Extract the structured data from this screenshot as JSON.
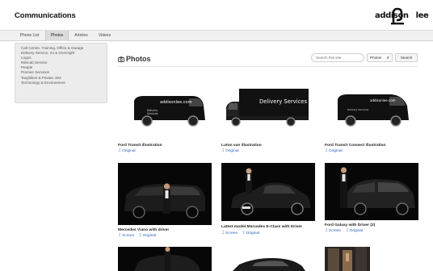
{
  "header": {
    "title": "Communications",
    "logo_text": "addison",
    "logo_text_2": "lee"
  },
  "nav": {
    "tabs": [
      {
        "label": "Phone List",
        "active": false
      },
      {
        "label": "Photos",
        "active": true
      },
      {
        "label": "Articles",
        "active": false
      },
      {
        "label": "Videos",
        "active": false
      }
    ]
  },
  "photos_menu": {
    "items": [
      "Call Centre, Training, Office & Garage",
      "Delivery Service, Int & Overnight",
      "Logos",
      "Minicab Service",
      "People",
      "Premier Services",
      "Taxybikes & Private Jets",
      "Technology & Environment"
    ]
  },
  "main": {
    "title": "Photos",
    "search": {
      "placeholder": "Search this site",
      "scope": "Photos",
      "button": "Search"
    }
  },
  "gallery": [
    {
      "caption": "Ford Transit illustration",
      "links": [
        "Original"
      ],
      "style": "white",
      "icon": "van-illustration"
    },
    {
      "caption": "Luton van illustration",
      "links": [
        "Original"
      ],
      "style": "white",
      "icon": "luton-van-illustration",
      "banner": "Delivery Services"
    },
    {
      "caption": "Ford Transit Connect illustration",
      "links": [
        "Original"
      ],
      "style": "white",
      "icon": "small-van-illustration"
    },
    {
      "caption": "Mercedes Viano with driver",
      "links": [
        "Screen",
        "Original"
      ],
      "style": "black",
      "icon": "mpv-photo"
    },
    {
      "caption": "Latest model Mercedes E-Class with Driver",
      "links": [
        "Screen",
        "Original"
      ],
      "style": "black",
      "icon": "saloon-photo"
    },
    {
      "caption": "Ford Galaxy with Driver (2)",
      "links": [
        "Screen",
        "Original"
      ],
      "style": "black",
      "icon": "mpv-photo"
    },
    {
      "caption": "",
      "links": [],
      "style": "black",
      "icon": "car-photo"
    },
    {
      "caption": "",
      "links": [],
      "style": "white",
      "icon": "car-photo"
    },
    {
      "caption": "",
      "links": [],
      "style": "black",
      "icon": "street-photo"
    }
  ],
  "colors": {
    "link": "#2a62b4",
    "nav_bg": "#f0f0f0",
    "menu_bg": "#ececec"
  }
}
